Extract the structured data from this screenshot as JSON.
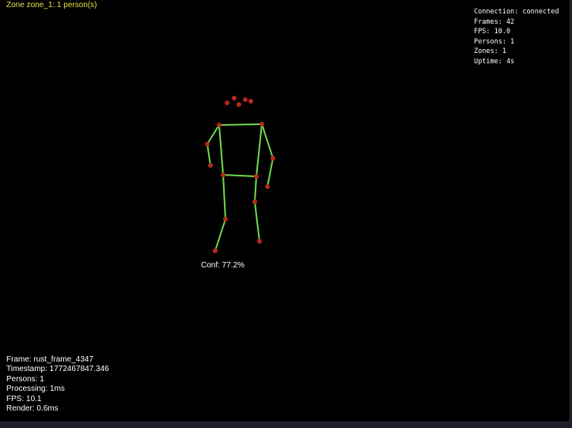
{
  "zone_label": "Zone zone_1: 1 person(s)",
  "stats": {
    "connection": "Connection: connected",
    "frames": "Frames: 42",
    "fps": "FPS: 10.0",
    "persons": "Persons: 1",
    "zones": "Zones: 1",
    "uptime": "Uptime: 4s"
  },
  "frame_info": {
    "frame": "Frame: rust_frame_4347",
    "timestamp": "Timestamp: 1772467847.346",
    "persons": "Persons: 1",
    "processing": "Processing: 1ms",
    "fps": "FPS: 10.1",
    "render": "Render: 0.6ms"
  },
  "pose": {
    "confidence_label": "Conf: 77.2%"
  },
  "colors": {
    "background": "#000000",
    "zone_label": "#e8e24a",
    "bone": "#6fd94f",
    "joint": "#b52a1c",
    "text": "#ffffff"
  }
}
